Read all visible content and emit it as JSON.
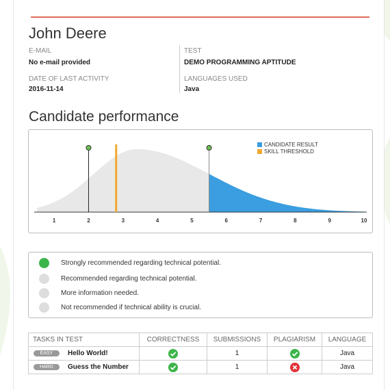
{
  "candidate": {
    "name": "John Deere",
    "email_label": "E-MAIL",
    "email_value": "No e-mail provided",
    "last_activity_label": "DATE OF LAST ACTIVITY",
    "last_activity_value": "2016-11-14",
    "test_label": "TEST",
    "test_value": "DEMO PROGRAMMING APTITUDE",
    "languages_label": "LANGUAGES USED",
    "languages_value": "Java"
  },
  "performance": {
    "title": "Candidate performance"
  },
  "chart_data": {
    "type": "area",
    "x_ticks": [
      "1",
      "2",
      "3",
      "4",
      "5",
      "6",
      "7",
      "8",
      "9",
      "10"
    ],
    "xlim": [
      1,
      10
    ],
    "candidate_result": 5.5,
    "skill_threshold": 2.8,
    "marker_line_x": 2,
    "legend": [
      {
        "name": "CANDIDATE RESULT",
        "color": "#3a9ee0"
      },
      {
        "name": "SKILL THRESHOLD",
        "color": "#f0a830"
      }
    ],
    "legend_position": "top-right",
    "distribution_color": "#e8e8e8"
  },
  "recommendations": [
    {
      "label": "Strongly recommended regarding technical potential.",
      "active": true
    },
    {
      "label": "Recommended regarding technical potential.",
      "active": false
    },
    {
      "label": "More information needed.",
      "active": false
    },
    {
      "label": "Not recommended if technical ability is crucial.",
      "active": false
    }
  ],
  "tasks_table": {
    "headers": [
      "TASKS IN TEST",
      "CORRECTNESS",
      "SUBMISSIONS",
      "PLAGIARISM",
      "LANGUAGE"
    ],
    "rows": [
      {
        "difficulty": "EASY",
        "name": "Hello World!",
        "correctness": "check-icon",
        "submissions": "1",
        "plagiarism": "check-icon",
        "language": "Java"
      },
      {
        "difficulty": "HARD",
        "name": "Guess the Number",
        "correctness": "check-icon",
        "submissions": "1",
        "plagiarism": "cross-icon",
        "language": "Java"
      }
    ]
  },
  "colors": {
    "accent_line": "#e06c5a",
    "green": "#3cb54a",
    "red": "#e0343a",
    "blue": "#3a9ee0",
    "orange": "#f0a830"
  }
}
